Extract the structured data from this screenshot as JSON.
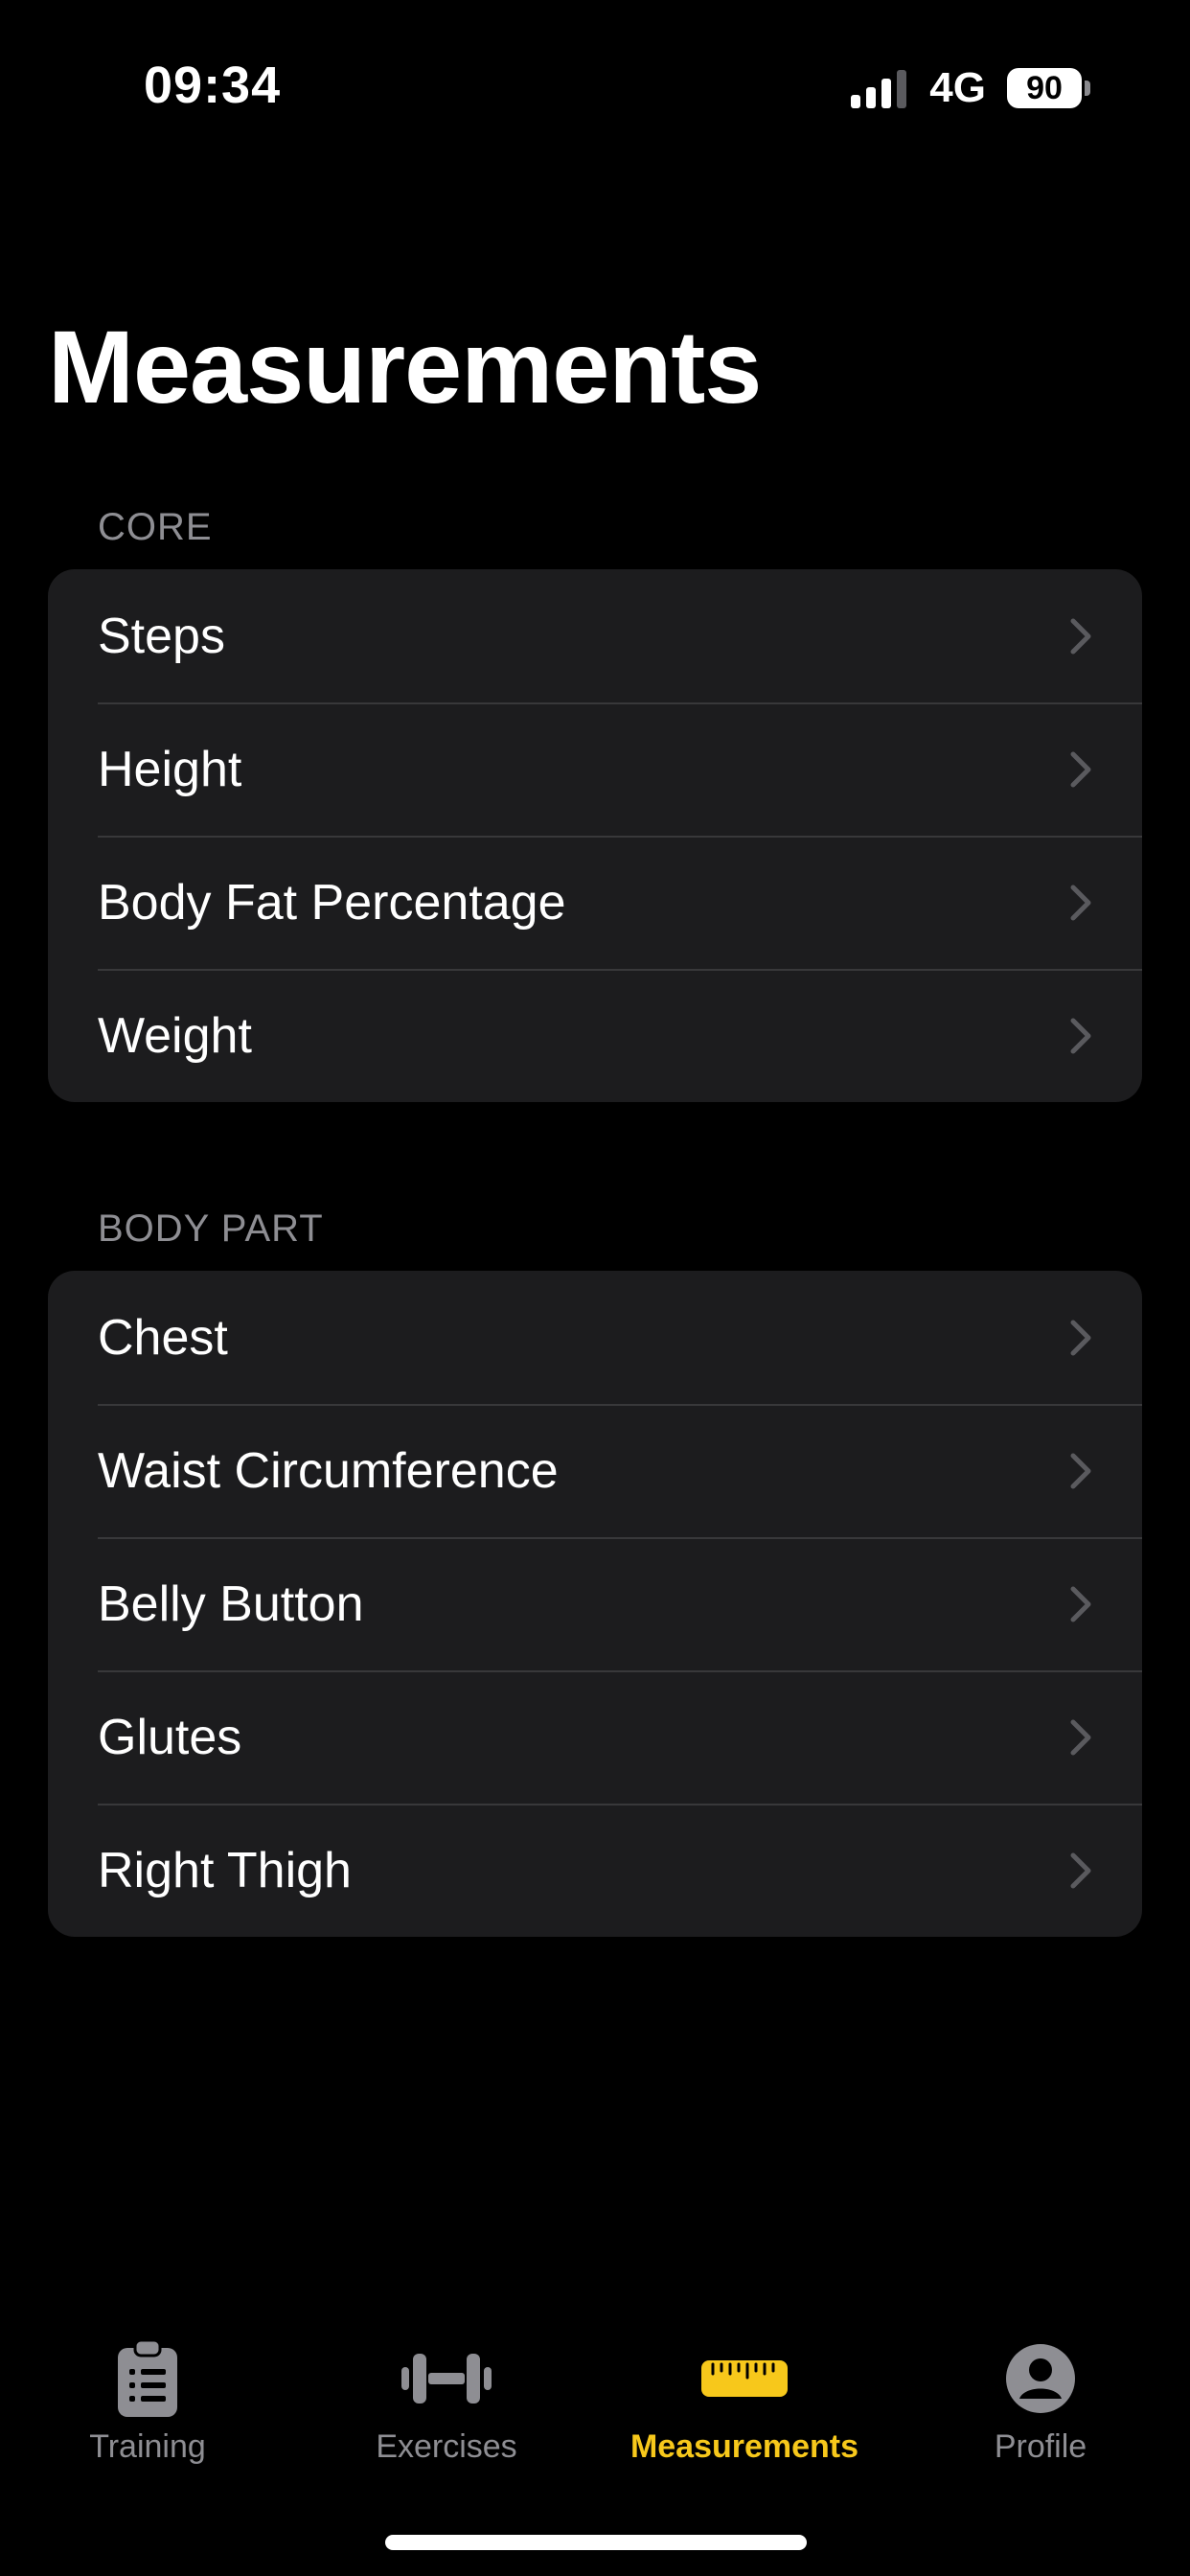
{
  "status_bar": {
    "time": "09:34",
    "network": "4G",
    "battery": "90"
  },
  "page": {
    "title": "Measurements"
  },
  "sections": {
    "core": {
      "header": "CORE",
      "items": [
        "Steps",
        "Height",
        "Body Fat Percentage",
        "Weight"
      ]
    },
    "body_part": {
      "header": "BODY PART",
      "items": [
        "Chest",
        "Waist Circumference",
        "Belly Button",
        "Glutes",
        "Right Thigh"
      ]
    }
  },
  "tabbar": {
    "tabs": [
      {
        "label": "Training",
        "icon": "clipboard-icon"
      },
      {
        "label": "Exercises",
        "icon": "dumbbell-icon"
      },
      {
        "label": "Measurements",
        "icon": "ruler-icon"
      },
      {
        "label": "Profile",
        "icon": "person-circle-icon"
      }
    ],
    "active_index": 2,
    "active_color": "#f7c81b",
    "inactive_color": "#8e8e93"
  }
}
